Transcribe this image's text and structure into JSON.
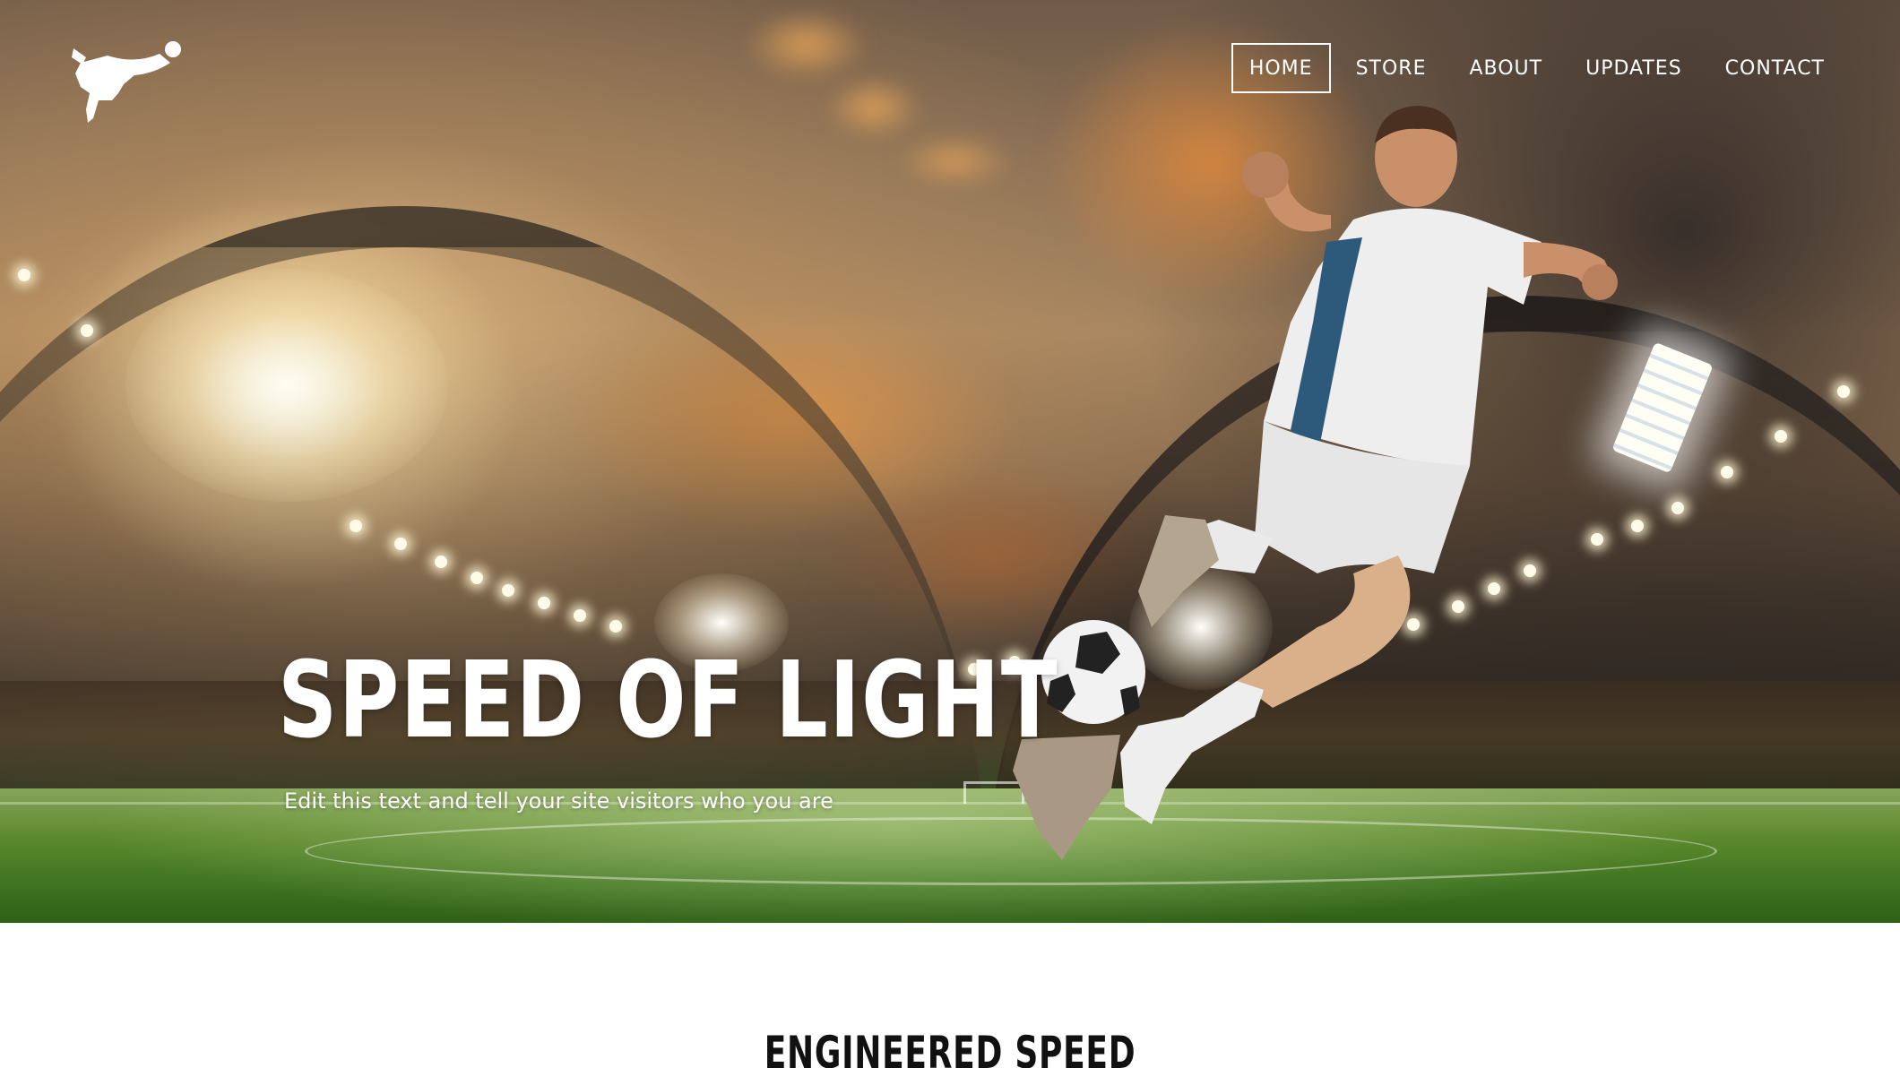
{
  "nav": {
    "logo_icon": "soccer-player-kick-icon",
    "items": [
      {
        "label": "HOME",
        "active": true
      },
      {
        "label": "STORE",
        "active": false
      },
      {
        "label": "ABOUT",
        "active": false
      },
      {
        "label": "UPDATES",
        "active": false
      },
      {
        "label": "CONTACT",
        "active": false
      }
    ]
  },
  "hero": {
    "title": "SPEED OF LIGHT",
    "subtitle": "Edit this text and tell your site visitors who you are",
    "background": "stadium-sunset-soccer-player-image"
  },
  "section": {
    "heading": "ENGINEERED SPEED"
  },
  "colors": {
    "nav_text": "#ffffff",
    "heading_text": "#111111",
    "page_background": "#ffffff"
  }
}
